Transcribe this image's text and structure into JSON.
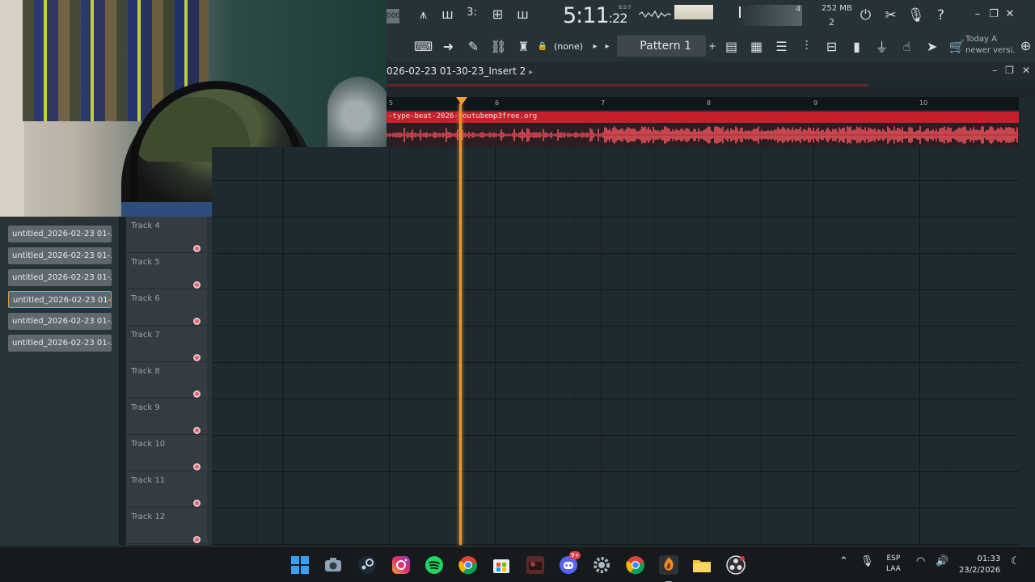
{
  "toolbar": {
    "counter": "000",
    "time_main": "5:11",
    "time_sub": ":22",
    "time_unit": "B:S:T",
    "meter_value": "4",
    "memory": "252 MB",
    "voices": "2",
    "pattern_selector": "(none)",
    "pattern_name": "Pattern 1",
    "news_line1": "Today  A",
    "news_line2": "newer versi."
  },
  "playlist": {
    "title": "026-02-23 01-30-23_Insert 2",
    "ruler_marks": [
      "5",
      "6",
      "7",
      "8",
      "9",
      "10"
    ],
    "clip_name": "-type-beat-2026-youtubemp3free.org"
  },
  "browser": {
    "items": [
      "untitled_2026-02-23 01-...",
      "untitled_2026-02-23 01-...",
      "untitled_2026-02-23 01-...",
      "untitled_2026-02-23 01-...",
      "untitled_2026-02-23 01-...",
      "untitled_2026-02-23 01-..."
    ],
    "selected_index": 3
  },
  "tracks": [
    "Track 4",
    "Track 5",
    "Track 6",
    "Track 7",
    "Track 8",
    "Track 9",
    "Track 10",
    "Track 11",
    "Track 12"
  ],
  "taskbar": {
    "apps": [
      "start-icon",
      "camera-icon",
      "steam-icon",
      "instagram-icon",
      "spotify-icon",
      "chrome-icon",
      "store-icon",
      "game-icon",
      "discord-icon",
      "settings-icon",
      "chrome-icon-2",
      "fl-studio-icon",
      "file-explorer-icon",
      "obs-icon"
    ],
    "discord_badge": "9+",
    "lang_line1": "ESP",
    "lang_line2": "LAA",
    "clock_time": "01:33",
    "clock_date": "23/2/2026"
  },
  "colors": {
    "clip_red": "#c7202c",
    "playhead": "#e8922c",
    "grid_bg": "#1f2a30",
    "toolbar_bg": "#273237"
  }
}
